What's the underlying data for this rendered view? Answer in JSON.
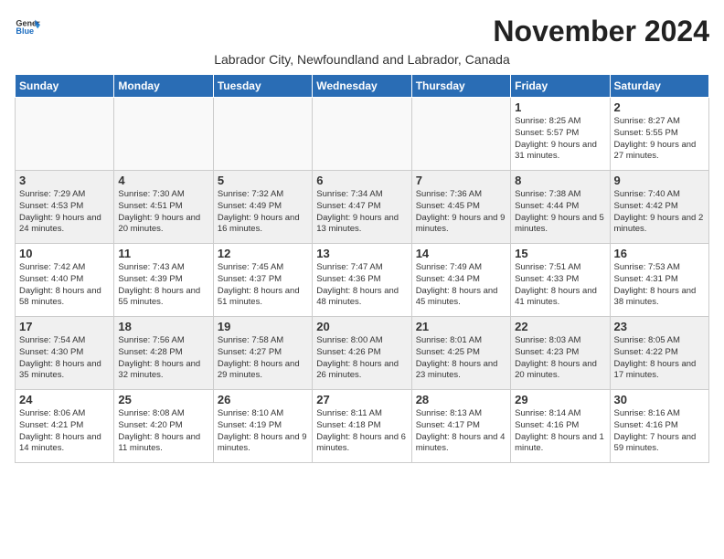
{
  "logo": {
    "general": "General",
    "blue": "Blue"
  },
  "title": "November 2024",
  "subtitle": "Labrador City, Newfoundland and Labrador, Canada",
  "days_of_week": [
    "Sunday",
    "Monday",
    "Tuesday",
    "Wednesday",
    "Thursday",
    "Friday",
    "Saturday"
  ],
  "weeks": [
    [
      {
        "day": "",
        "content": ""
      },
      {
        "day": "",
        "content": ""
      },
      {
        "day": "",
        "content": ""
      },
      {
        "day": "",
        "content": ""
      },
      {
        "day": "",
        "content": ""
      },
      {
        "day": "1",
        "content": "Sunrise: 8:25 AM\nSunset: 5:57 PM\nDaylight: 9 hours and 31 minutes."
      },
      {
        "day": "2",
        "content": "Sunrise: 8:27 AM\nSunset: 5:55 PM\nDaylight: 9 hours and 27 minutes."
      }
    ],
    [
      {
        "day": "3",
        "content": "Sunrise: 7:29 AM\nSunset: 4:53 PM\nDaylight: 9 hours and 24 minutes."
      },
      {
        "day": "4",
        "content": "Sunrise: 7:30 AM\nSunset: 4:51 PM\nDaylight: 9 hours and 20 minutes."
      },
      {
        "day": "5",
        "content": "Sunrise: 7:32 AM\nSunset: 4:49 PM\nDaylight: 9 hours and 16 minutes."
      },
      {
        "day": "6",
        "content": "Sunrise: 7:34 AM\nSunset: 4:47 PM\nDaylight: 9 hours and 13 minutes."
      },
      {
        "day": "7",
        "content": "Sunrise: 7:36 AM\nSunset: 4:45 PM\nDaylight: 9 hours and 9 minutes."
      },
      {
        "day": "8",
        "content": "Sunrise: 7:38 AM\nSunset: 4:44 PM\nDaylight: 9 hours and 5 minutes."
      },
      {
        "day": "9",
        "content": "Sunrise: 7:40 AM\nSunset: 4:42 PM\nDaylight: 9 hours and 2 minutes."
      }
    ],
    [
      {
        "day": "10",
        "content": "Sunrise: 7:42 AM\nSunset: 4:40 PM\nDaylight: 8 hours and 58 minutes."
      },
      {
        "day": "11",
        "content": "Sunrise: 7:43 AM\nSunset: 4:39 PM\nDaylight: 8 hours and 55 minutes."
      },
      {
        "day": "12",
        "content": "Sunrise: 7:45 AM\nSunset: 4:37 PM\nDaylight: 8 hours and 51 minutes."
      },
      {
        "day": "13",
        "content": "Sunrise: 7:47 AM\nSunset: 4:36 PM\nDaylight: 8 hours and 48 minutes."
      },
      {
        "day": "14",
        "content": "Sunrise: 7:49 AM\nSunset: 4:34 PM\nDaylight: 8 hours and 45 minutes."
      },
      {
        "day": "15",
        "content": "Sunrise: 7:51 AM\nSunset: 4:33 PM\nDaylight: 8 hours and 41 minutes."
      },
      {
        "day": "16",
        "content": "Sunrise: 7:53 AM\nSunset: 4:31 PM\nDaylight: 8 hours and 38 minutes."
      }
    ],
    [
      {
        "day": "17",
        "content": "Sunrise: 7:54 AM\nSunset: 4:30 PM\nDaylight: 8 hours and 35 minutes."
      },
      {
        "day": "18",
        "content": "Sunrise: 7:56 AM\nSunset: 4:28 PM\nDaylight: 8 hours and 32 minutes."
      },
      {
        "day": "19",
        "content": "Sunrise: 7:58 AM\nSunset: 4:27 PM\nDaylight: 8 hours and 29 minutes."
      },
      {
        "day": "20",
        "content": "Sunrise: 8:00 AM\nSunset: 4:26 PM\nDaylight: 8 hours and 26 minutes."
      },
      {
        "day": "21",
        "content": "Sunrise: 8:01 AM\nSunset: 4:25 PM\nDaylight: 8 hours and 23 minutes."
      },
      {
        "day": "22",
        "content": "Sunrise: 8:03 AM\nSunset: 4:23 PM\nDaylight: 8 hours and 20 minutes."
      },
      {
        "day": "23",
        "content": "Sunrise: 8:05 AM\nSunset: 4:22 PM\nDaylight: 8 hours and 17 minutes."
      }
    ],
    [
      {
        "day": "24",
        "content": "Sunrise: 8:06 AM\nSunset: 4:21 PM\nDaylight: 8 hours and 14 minutes."
      },
      {
        "day": "25",
        "content": "Sunrise: 8:08 AM\nSunset: 4:20 PM\nDaylight: 8 hours and 11 minutes."
      },
      {
        "day": "26",
        "content": "Sunrise: 8:10 AM\nSunset: 4:19 PM\nDaylight: 8 hours and 9 minutes."
      },
      {
        "day": "27",
        "content": "Sunrise: 8:11 AM\nSunset: 4:18 PM\nDaylight: 8 hours and 6 minutes."
      },
      {
        "day": "28",
        "content": "Sunrise: 8:13 AM\nSunset: 4:17 PM\nDaylight: 8 hours and 4 minutes."
      },
      {
        "day": "29",
        "content": "Sunrise: 8:14 AM\nSunset: 4:16 PM\nDaylight: 8 hours and 1 minute."
      },
      {
        "day": "30",
        "content": "Sunrise: 8:16 AM\nSunset: 4:16 PM\nDaylight: 7 hours and 59 minutes."
      }
    ]
  ]
}
